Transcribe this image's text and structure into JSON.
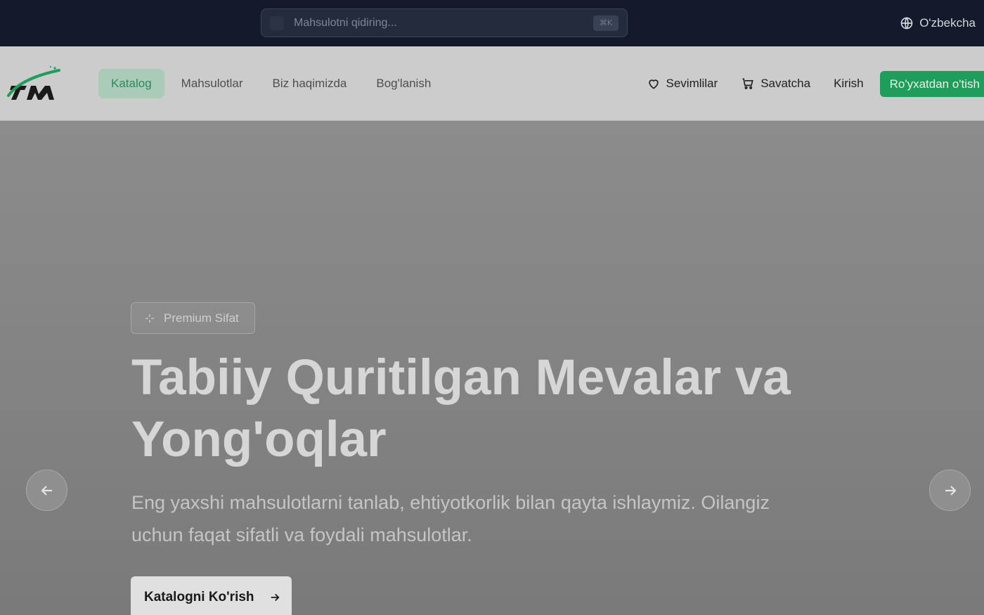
{
  "topbar": {
    "search": {
      "placeholder": "Mahsulotni qidiring...",
      "shortcut": "⌘K"
    },
    "language": "O'zbekcha"
  },
  "nav": {
    "logo_alt": "TM",
    "links": [
      {
        "label": "Katalog",
        "active": true
      },
      {
        "label": "Mahsulotlar",
        "active": false
      },
      {
        "label": "Biz haqimizda",
        "active": false
      },
      {
        "label": "Bog'lanish",
        "active": false
      }
    ],
    "favorites": "Sevimlilar",
    "cart": "Savatcha",
    "login": "Kirish",
    "register": "Ro'yxatdan o'tish"
  },
  "hero": {
    "badge": "Premium Sifat",
    "title": "Tabiiy Quritilgan Mevalar va Yong'oqlar",
    "subtitle": "Eng yaxshi mahsulotlarni tanlab, ehtiyotkorlik bilan qayta ishlaymiz. Oilangiz uchun faqat sifatli va foydali mahsulotlar.",
    "cta": "Katalogni Ko'rish"
  },
  "colors": {
    "brand_green": "#1e9e5a",
    "topbar_bg": "#141a2b"
  }
}
